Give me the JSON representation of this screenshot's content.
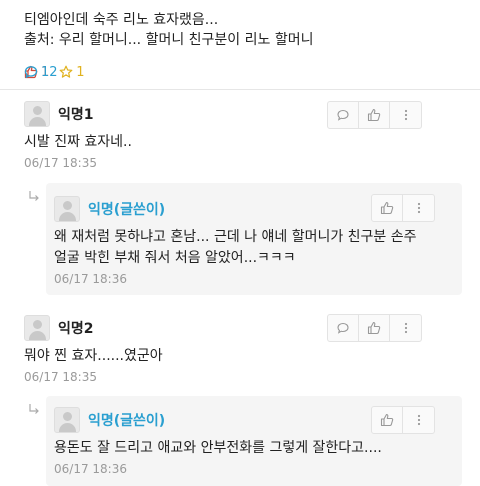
{
  "post": {
    "lines": [
      "티엠아인데 숙주 리노 효자랬음...",
      "출처: 우리 할머니... 할머니 친구분이 리노 할머니"
    ],
    "stats": {
      "likes": "1",
      "comments": "12",
      "scraps": "1"
    }
  },
  "comments": [
    {
      "nickname": "익명1",
      "text": [
        "시발 진짜 효자네.."
      ],
      "time": "06/17 18:35",
      "reply": {
        "nickname": "익명(글쓴이)",
        "text": [
          "왜 재처럼 못하냐고 혼남... 근데 나 얘네 할머니가 친구분 손주",
          "얼굴 박힌 부채 줘서 처음 알았어...ㅋㅋㅋ"
        ],
        "time": "06/17 18:36"
      }
    },
    {
      "nickname": "익명2",
      "text": [
        "뭐야 찐 효자......였군아"
      ],
      "time": "06/17 18:35",
      "reply": {
        "nickname": "익명(글쓴이)",
        "text": [
          "용돈도 잘 드리고 애교와 안부전화를 그렇게 잘한다고...."
        ],
        "time": "06/17 18:36"
      }
    }
  ],
  "colors": {
    "like": "#d24a3a",
    "comment": "#2a9fd0",
    "scrap": "#e0b21f",
    "writer": "#2a9fd0"
  },
  "icons": [
    "thumbs-up-icon",
    "comment-bubble-icon",
    "star-icon",
    "more-vertical-icon",
    "reply-arrow-icon",
    "avatar-icon"
  ]
}
